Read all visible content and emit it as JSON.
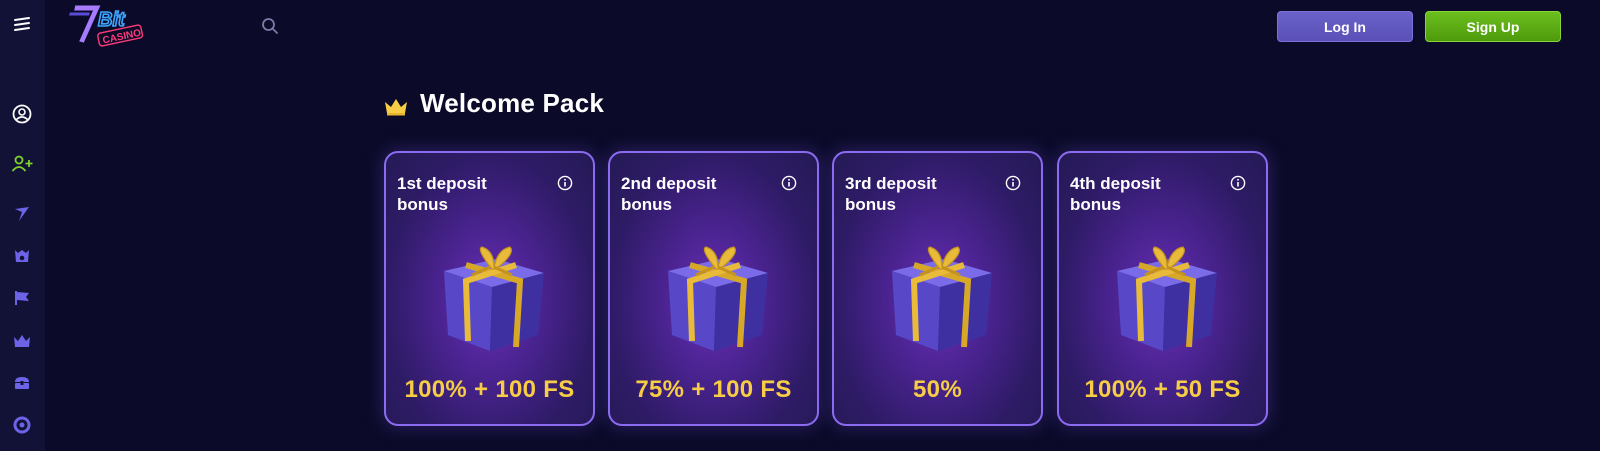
{
  "header": {
    "logo_icon": "7bit-casino-logo",
    "search_icon": "search-icon",
    "login_label": "Log In",
    "signup_label": "Sign Up"
  },
  "sidebar": {
    "items": [
      {
        "icon": "menu-icon"
      },
      {
        "icon": "user-circle-icon"
      },
      {
        "icon": "add-user-icon"
      },
      {
        "icon": "rocket-icon"
      },
      {
        "icon": "slots-icon"
      },
      {
        "icon": "flag-icon"
      },
      {
        "icon": "crown-icon"
      },
      {
        "icon": "treasure-chest-icon"
      },
      {
        "icon": "support-icon"
      }
    ]
  },
  "welcome": {
    "title": "Welcome Pack",
    "cards": [
      {
        "title": "1st deposit bonus",
        "value": "100% + 100 FS"
      },
      {
        "title": "2nd deposit bonus",
        "value": "75% + 100 FS"
      },
      {
        "title": "3rd deposit bonus",
        "value": "50%"
      },
      {
        "title": "4th deposit bonus",
        "value": "100% + 50 FS"
      }
    ]
  },
  "colors": {
    "background": "#0b0b29",
    "sidebar": "#121236",
    "accent_gold": "#f7cd45",
    "card_border": "#8b6bf0",
    "login": "#6a62c8",
    "signup": "#6cbf1e"
  }
}
